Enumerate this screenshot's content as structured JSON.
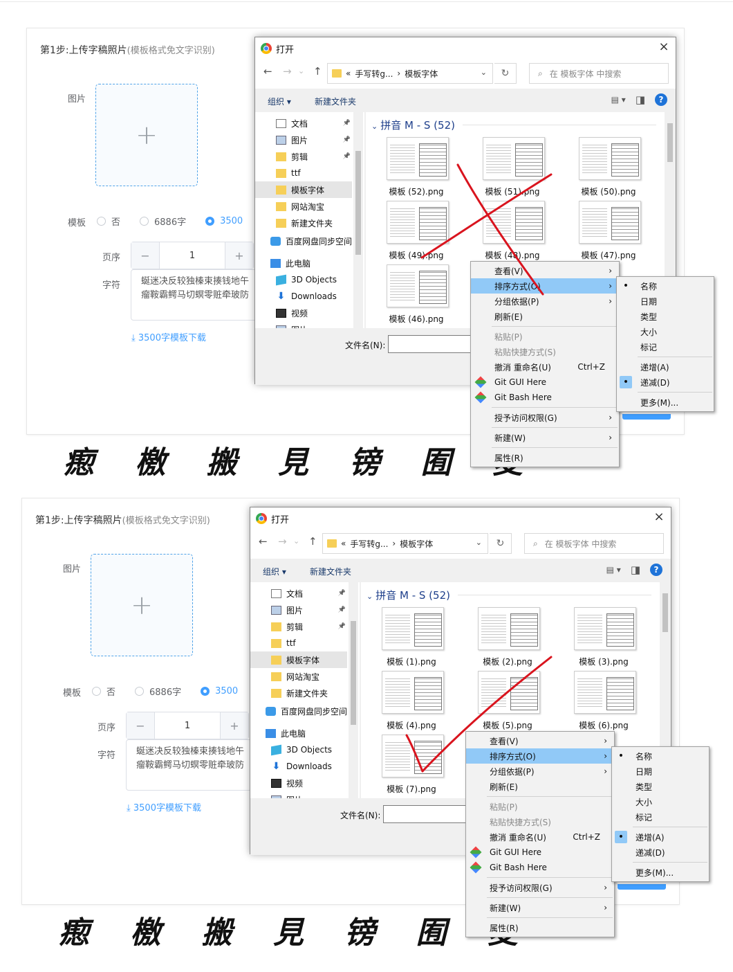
{
  "panels": [
    {
      "form": {
        "step_title": "第1步:上传字稿照片",
        "step_note": "(模板格式免文字识别)",
        "image_label": "图片",
        "upload_plus": "+",
        "template_label": "模板",
        "radio_no": "否",
        "radio_6886": "6886字",
        "radio_3500": "3500",
        "page_label": "页序",
        "page_minus": "−",
        "page_value": "1",
        "page_plus": "+",
        "chars_label": "字符",
        "chars_line1": "蜒迷决反较独榛束揍钱地午",
        "chars_line2": "瘤鞍霸鳄马切螟零赃牵玻防",
        "download_link": "⤓ 3500字模板下载",
        "handwriting": "瘛 檄 搬 見 镑 囿 麦"
      },
      "dialog": {
        "title": "打开",
        "close": "×",
        "back": "←",
        "forward": "→",
        "recent": "⌄",
        "up": "↑",
        "crumb_prev": "«",
        "crumb1": "手写转g...",
        "crumb_sep": "›",
        "crumb2": "模板字体",
        "addr_dd": "⌄",
        "refresh": "↻",
        "search_placeholder": "在 模板字体 中搜索",
        "search_icon": "⌕",
        "organize": "组织 ▾",
        "new_folder": "新建文件夹",
        "view_icon": "▤ ▾",
        "pane_icon": "◨",
        "help": "?",
        "nav": [
          {
            "icon": "doc",
            "label": "文档",
            "pin": true,
            "sel": false
          },
          {
            "icon": "pic",
            "label": "图片",
            "pin": true,
            "sel": false
          },
          {
            "icon": "folder",
            "label": "剪辑",
            "pin": true,
            "sel": false
          },
          {
            "icon": "folder",
            "label": "ttf",
            "pin": false,
            "sel": false
          },
          {
            "icon": "folder",
            "label": "模板字体",
            "pin": false,
            "sel": true
          },
          {
            "icon": "folder",
            "label": "网站淘宝",
            "pin": false,
            "sel": false
          },
          {
            "icon": "folder",
            "label": "新建文件夹",
            "pin": false,
            "sel": false
          },
          {
            "icon": "cloud",
            "label": "百度网盘同步空间",
            "pin": false,
            "sel": false
          },
          {
            "icon": "pc",
            "label": "此电脑",
            "pin": false,
            "sel": false
          },
          {
            "icon": "cube",
            "label": "3D Objects",
            "pin": false,
            "sel": false
          },
          {
            "icon": "down",
            "label": "Downloads",
            "pin": false,
            "sel": false
          },
          {
            "icon": "video",
            "label": "视频",
            "pin": false,
            "sel": false
          },
          {
            "icon": "pic",
            "label": "图片",
            "pin": false,
            "sel": false
          }
        ],
        "group_header": "拼音 M - S (52)",
        "files": [
          "模板 (52).png",
          "模板 (51).png",
          "模板 (50).png",
          "模板 (49).png",
          "模板 (48).png",
          "模板 (47).png",
          "模板 (46).png"
        ],
        "filename_label": "文件名(N):",
        "context_menu": [
          {
            "label": "查看(V)",
            "arrow": true
          },
          {
            "label": "排序方式(O)",
            "arrow": true,
            "hl": true
          },
          {
            "label": "分组依据(P)",
            "arrow": true
          },
          {
            "label": "刷新(E)"
          },
          {
            "sep": true
          },
          {
            "label": "粘贴(P)",
            "dis": true
          },
          {
            "label": "粘贴快捷方式(S)",
            "dis": true
          },
          {
            "label": "撤消 重命名(U)",
            "shortcut": "Ctrl+Z"
          },
          {
            "label": "Git GUI Here",
            "git": true
          },
          {
            "label": "Git Bash Here",
            "git": true
          },
          {
            "sep": true
          },
          {
            "label": "授予访问权限(G)",
            "arrow": true
          },
          {
            "sep": true
          },
          {
            "label": "新建(W)",
            "arrow": true
          },
          {
            "sep": true
          },
          {
            "label": "属性(R)"
          }
        ],
        "sort_menu": [
          {
            "label": "名称",
            "dot": true
          },
          {
            "label": "日期"
          },
          {
            "label": "类型"
          },
          {
            "label": "大小"
          },
          {
            "label": "标记"
          },
          {
            "sep": true
          },
          {
            "label": "递增(A)"
          },
          {
            "label": "递减(D)",
            "dot": true,
            "bg": true
          },
          {
            "sep": true
          },
          {
            "label": "更多(M)..."
          }
        ]
      },
      "annotation": "cross"
    },
    {
      "form": {
        "step_title": "第1步:上传字稿照片",
        "step_note": "(模板格式免文字识别)",
        "image_label": "图片",
        "upload_plus": "+",
        "template_label": "模板",
        "radio_no": "否",
        "radio_6886": "6886字",
        "radio_3500": "3500",
        "page_label": "页序",
        "page_minus": "−",
        "page_value": "1",
        "page_plus": "+",
        "chars_label": "字符",
        "chars_line1": "蜒迷决反较独榛束揍钱地午",
        "chars_line2": "瘤鞍霸鳄马切螟零赃牵玻防",
        "download_link": "⤓ 3500字模板下载",
        "handwriting": "瘛 檄 搬 見 镑 囿 麦"
      },
      "dialog": {
        "title": "打开",
        "close": "×",
        "back": "←",
        "forward": "→",
        "recent": "⌄",
        "up": "↑",
        "crumb_prev": "«",
        "crumb1": "手写转g...",
        "crumb_sep": "›",
        "crumb2": "模板字体",
        "addr_dd": "⌄",
        "refresh": "↻",
        "search_placeholder": "在 模板字体 中搜索",
        "search_icon": "⌕",
        "organize": "组织 ▾",
        "new_folder": "新建文件夹",
        "view_icon": "▤ ▾",
        "pane_icon": "◨",
        "help": "?",
        "nav": [
          {
            "icon": "doc",
            "label": "文档",
            "pin": true,
            "sel": false
          },
          {
            "icon": "pic",
            "label": "图片",
            "pin": true,
            "sel": false
          },
          {
            "icon": "folder",
            "label": "剪辑",
            "pin": true,
            "sel": false
          },
          {
            "icon": "folder",
            "label": "ttf",
            "pin": false,
            "sel": false
          },
          {
            "icon": "folder",
            "label": "模板字体",
            "pin": false,
            "sel": true
          },
          {
            "icon": "folder",
            "label": "网站淘宝",
            "pin": false,
            "sel": false
          },
          {
            "icon": "folder",
            "label": "新建文件夹",
            "pin": false,
            "sel": false
          },
          {
            "icon": "cloud",
            "label": "百度网盘同步空间",
            "pin": false,
            "sel": false
          },
          {
            "icon": "pc",
            "label": "此电脑",
            "pin": false,
            "sel": false
          },
          {
            "icon": "cube",
            "label": "3D Objects",
            "pin": false,
            "sel": false
          },
          {
            "icon": "down",
            "label": "Downloads",
            "pin": false,
            "sel": false
          },
          {
            "icon": "video",
            "label": "视频",
            "pin": false,
            "sel": false
          },
          {
            "icon": "pic",
            "label": "图片",
            "pin": false,
            "sel": false
          }
        ],
        "group_header": "拼音 M - S (52)",
        "files": [
          "模板 (1).png",
          "模板 (2).png",
          "模板 (3).png",
          "模板 (4).png",
          "模板 (5).png",
          "模板 (6).png",
          "模板 (7).png"
        ],
        "filename_label": "文件名(N):",
        "context_menu": [
          {
            "label": "查看(V)",
            "arrow": true
          },
          {
            "label": "排序方式(O)",
            "arrow": true,
            "hl": true
          },
          {
            "label": "分组依据(P)",
            "arrow": true
          },
          {
            "label": "刷新(E)"
          },
          {
            "sep": true
          },
          {
            "label": "粘贴(P)",
            "dis": true
          },
          {
            "label": "粘贴快捷方式(S)",
            "dis": true
          },
          {
            "label": "撤消 重命名(U)",
            "shortcut": "Ctrl+Z"
          },
          {
            "label": "Git GUI Here",
            "git": true
          },
          {
            "label": "Git Bash Here",
            "git": true
          },
          {
            "sep": true
          },
          {
            "label": "授予访问权限(G)",
            "arrow": true
          },
          {
            "sep": true
          },
          {
            "label": "新建(W)",
            "arrow": true
          },
          {
            "sep": true
          },
          {
            "label": "属性(R)"
          }
        ],
        "sort_menu": [
          {
            "label": "名称",
            "dot": true
          },
          {
            "label": "日期"
          },
          {
            "label": "类型"
          },
          {
            "label": "大小"
          },
          {
            "label": "标记"
          },
          {
            "sep": true
          },
          {
            "label": "递增(A)",
            "dot": true,
            "bg": true
          },
          {
            "label": "递减(D)"
          },
          {
            "sep": true
          },
          {
            "label": "更多(M)..."
          }
        ]
      },
      "annotation": "check"
    }
  ],
  "colors": {
    "accent": "#409eff",
    "menu_highlight": "#91c9f7",
    "annotation_red": "#d9141e",
    "folder": "#f6cf58"
  }
}
